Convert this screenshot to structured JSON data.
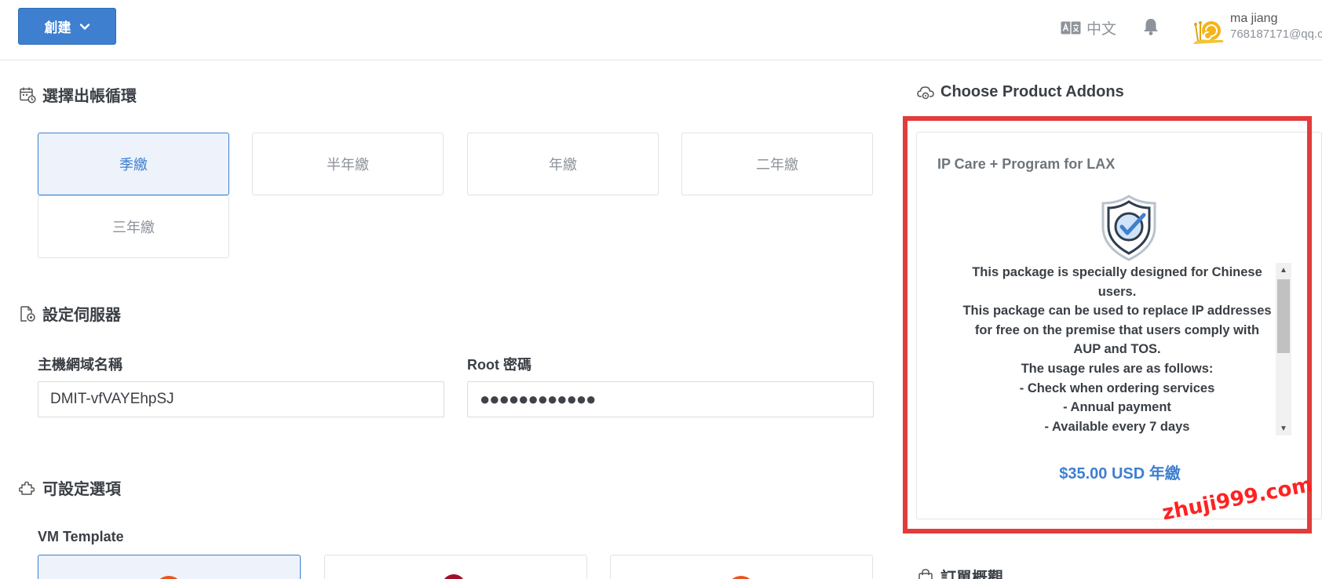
{
  "header": {
    "create_label": "創建",
    "language_label": "中文",
    "user_name": "ma jiang",
    "user_email": "768187171@qq.c"
  },
  "billing": {
    "title": "選擇出帳循環",
    "options": [
      {
        "label": "季繳",
        "selected": true
      },
      {
        "label": "半年繳",
        "selected": false
      },
      {
        "label": "年繳",
        "selected": false
      },
      {
        "label": "二年繳",
        "selected": false
      },
      {
        "label": "三年繳",
        "selected": false
      }
    ]
  },
  "server": {
    "title": "設定伺服器",
    "hostname_label": "主機網域名稱",
    "hostname_value": "DMIT-vfVAYEhpSJ",
    "root_label": "Root 密碼",
    "root_value": "●●●●●●●●●●●●"
  },
  "configurable": {
    "title": "可設定選項",
    "vm_template_label": "VM Template"
  },
  "addons": {
    "title": "Choose Product Addons",
    "card_title": "IP Care + Program for LAX",
    "description_lines": [
      "This package is specially designed for Chinese",
      "users.",
      "This package can be used to replace IP addresses",
      "for free on the premise that users comply with",
      "AUP and TOS.",
      "The usage rules are as follows:",
      "- Check when ordering services",
      "- Annual payment",
      "- Available every 7 days"
    ],
    "price": "$35.00 USD 年繳"
  },
  "order_summary": {
    "title": "訂單概觀"
  },
  "watermark": "zhuji999.com",
  "colors": {
    "accent": "#3e7fd0",
    "selected_bg": "#edf2fb",
    "highlight_frame": "#e23c3c"
  }
}
